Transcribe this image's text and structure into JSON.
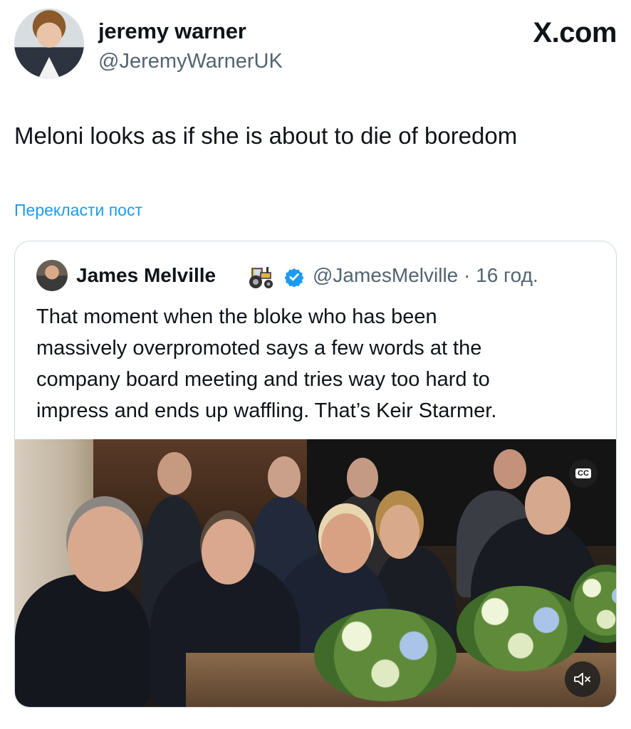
{
  "author": {
    "display_name": "jeremy warner",
    "handle": "@JeremyWarnerUK"
  },
  "site_logo": "X.com",
  "tweet": {
    "text": "Meloni looks as if she is about to die of boredom",
    "translate_link": "Перекласти пост"
  },
  "quoted": {
    "display_name": "James Melville",
    "emoji_icon": "tractor-icon",
    "verified_icon": "verified-badge-icon",
    "handle_time": "@JamesMelville · 16 год.",
    "text_lines": [
      "That moment when the bloke who has been",
      "massively overpromoted says a few words at the",
      "company board meeting and tries way too hard to",
      "impress and ends up waffling. That’s Keir Starmer."
    ],
    "media": {
      "cc_label": "CC",
      "mute_icon": "speaker-muted-icon"
    }
  },
  "colors": {
    "link": "#1d9bf0",
    "secondary_text": "#536471",
    "verified": "#1d9bf0"
  }
}
